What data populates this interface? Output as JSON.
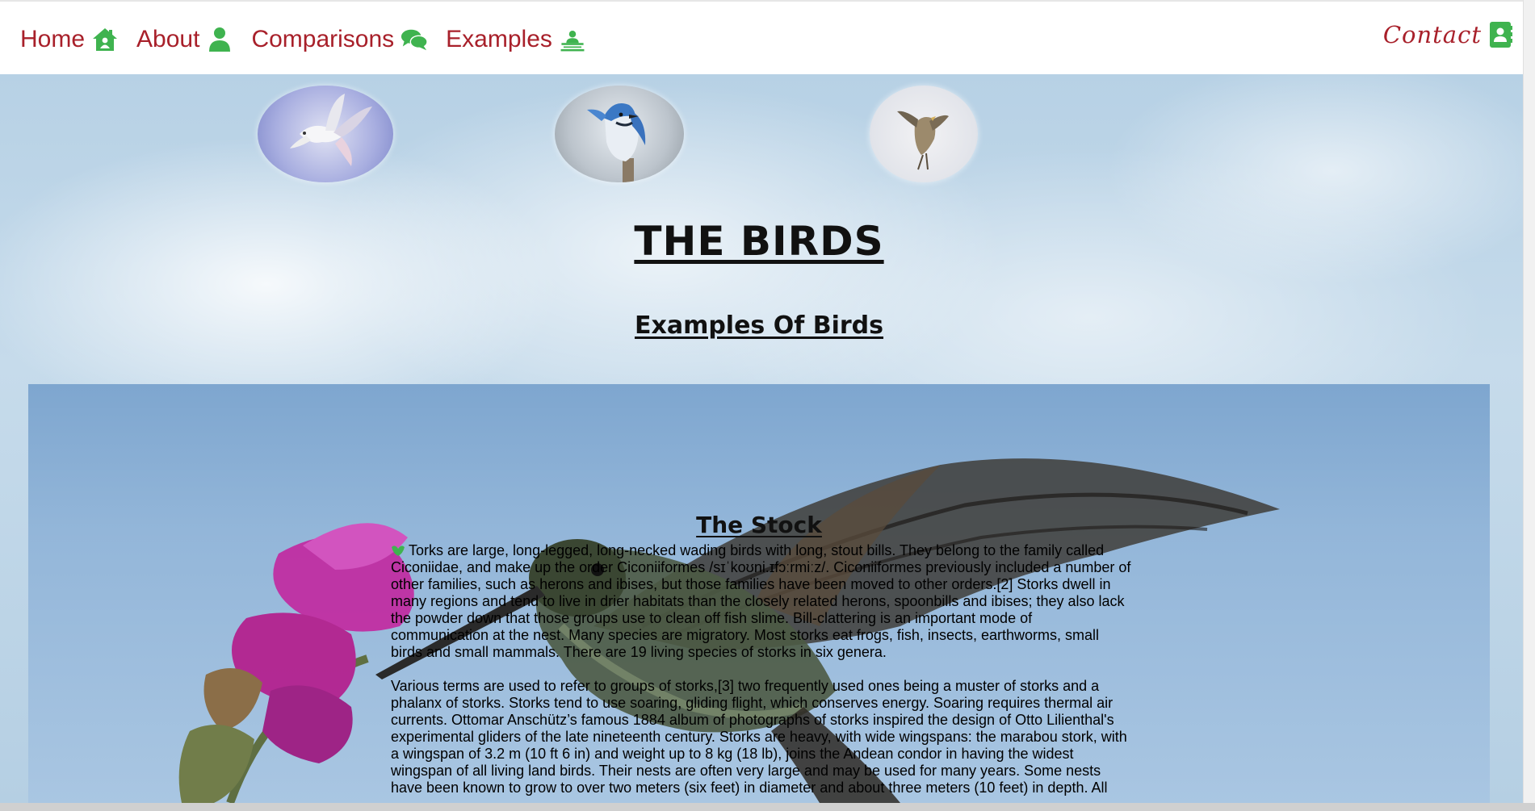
{
  "nav": {
    "items": [
      {
        "label": "Home",
        "icon": "home-icon"
      },
      {
        "label": "About",
        "icon": "user-icon"
      },
      {
        "label": "Comparisons",
        "icon": "comments-icon"
      },
      {
        "label": "Examples",
        "icon": "teacher-icon"
      }
    ],
    "contact": {
      "label": "Contact",
      "icon": "address-book-icon"
    },
    "link_color": "#a8202a",
    "icon_color": "#3fb34f"
  },
  "thumbnails": [
    {
      "icon": "dove-image"
    },
    {
      "icon": "blue-jay-image"
    },
    {
      "icon": "finch-image"
    }
  ],
  "header": {
    "title": "THE BIRDS",
    "subtitle": "Examples Of Birds"
  },
  "section": {
    "title": "The Stock",
    "paragraphs": [
      "Torks are large, long-legged, long-necked wading birds with long, stout bills. They belong to the family called Ciconiidae, and make up the order Ciconiiformes /sɪˈkoʊni.ɪfɔːrmiːz/. Ciconiiformes previously included a number of other families, such as herons and ibises, but those families have been moved to other orders.[2] Storks dwell in many regions and tend to live in drier habitats than the closely related herons, spoonbills and ibises; they also lack the powder down that those groups use to clean off fish slime. Bill-clattering is an important mode of communication at the nest. Many species are migratory. Most storks eat frogs, fish, insects, earthworms, small birds and small mammals. There are 19 living species of storks in six genera.",
      "Various terms are used to refer to groups of storks,[3] two frequently used ones being a muster of storks and a phalanx of storks. Storks tend to use soaring, gliding flight, which conserves energy. Soaring requires thermal air currents. Ottomar Anschütz’s famous 1884 album of photographs of storks inspired the design of Otto Lilienthal's experimental gliders of the late nineteenth century. Storks are heavy, with wide wingspans: the marabou stork, with a wingspan of 3.2 m (10 ft 6 in) and weight up to 8 kg (18 lb), joins the Andean condor in having the widest wingspan of all living land birds. Their nests are often very large and may be used for many years. Some nests have been known to grow to over two meters (six feet) in diameter and about three meters (10 feet) in depth. All"
    ]
  }
}
